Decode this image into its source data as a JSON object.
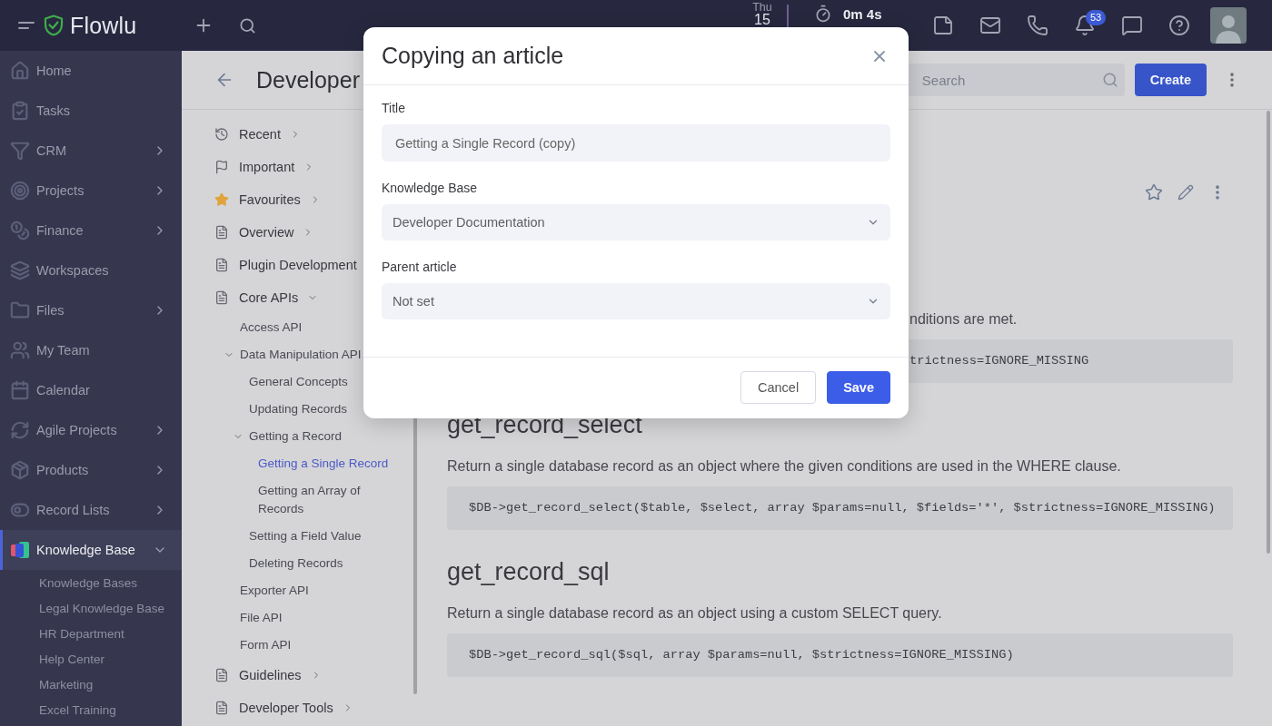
{
  "top_bar": {
    "brand": "Flowlu",
    "date": {
      "weekday": "Thu",
      "day": "15"
    },
    "timer": "0m 4s",
    "notification_count": "53"
  },
  "sidebar": {
    "items": [
      {
        "label": "Home",
        "selected": false
      },
      {
        "label": "Tasks",
        "selected": false
      },
      {
        "label": "CRM",
        "selected": false,
        "expanded": false
      },
      {
        "label": "Projects",
        "selected": false,
        "expanded": false
      },
      {
        "label": "Finance",
        "selected": false,
        "expanded": false
      },
      {
        "label": "Workspaces",
        "selected": false
      },
      {
        "label": "Files",
        "selected": false,
        "expanded": false
      },
      {
        "label": "My Team",
        "selected": false
      },
      {
        "label": "Calendar",
        "selected": false
      },
      {
        "label": "Agile Projects",
        "selected": false,
        "expanded": false
      },
      {
        "label": "Products",
        "selected": false,
        "expanded": false
      },
      {
        "label": "Record Lists",
        "selected": false,
        "expanded": false
      },
      {
        "label": "Knowledge Base",
        "selected": true,
        "expanded": true,
        "children": [
          {
            "label": "Knowledge Bases",
            "selected": false
          },
          {
            "label": "Legal Knowledge Base",
            "selected": false
          },
          {
            "label": "HR Department",
            "selected": false
          },
          {
            "label": "Help Center",
            "selected": false
          },
          {
            "label": "Marketing",
            "selected": false
          },
          {
            "label": "Excel Training",
            "selected": false
          }
        ]
      }
    ]
  },
  "page": {
    "title": "Developer",
    "search": {
      "placeholder": "Search"
    },
    "create_button": "Create"
  },
  "tree": {
    "items": [
      {
        "label": "Recent",
        "selected": false,
        "expanded": false
      },
      {
        "label": "Important",
        "selected": false,
        "expanded": false
      },
      {
        "label": "Favourites",
        "selected": false,
        "expanded": false
      },
      {
        "label": "Overview",
        "selected": false,
        "expanded": false
      },
      {
        "label": "Plugin Development",
        "selected": false
      },
      {
        "label": "Core APIs",
        "selected": false,
        "expanded": true,
        "children": [
          {
            "label": "Access API",
            "selected": false
          },
          {
            "label": "Data Manipulation API",
            "selected": false,
            "expanded": true,
            "children": [
              {
                "label": "General Concepts",
                "selected": false
              },
              {
                "label": "Updating Records",
                "selected": false
              },
              {
                "label": "Getting a Record",
                "selected": false,
                "expanded": true,
                "children": [
                  {
                    "label": "Getting a Single Record",
                    "selected": true
                  },
                  {
                    "label": "Getting an Array of Records",
                    "selected": false
                  }
                ]
              },
              {
                "label": "Setting a Field Value",
                "selected": false
              },
              {
                "label": "Deleting Records",
                "selected": false
              }
            ]
          },
          {
            "label": "Exporter API",
            "selected": false
          },
          {
            "label": "File API",
            "selected": false
          },
          {
            "label": "Form API",
            "selected": false
          }
        ]
      },
      {
        "label": "Guidelines",
        "selected": false,
        "expanded": false
      },
      {
        "label": "Developer Tools",
        "selected": false,
        "expanded": false
      }
    ]
  },
  "article": {
    "behind_dialog": [
      {
        "kind": "text",
        "text": "nditions are met."
      },
      {
        "kind": "code",
        "text": "trictness=IGNORE_MISSING"
      }
    ],
    "sections": [
      {
        "heading": "get_record_select",
        "description": "Return a single database record as an object where the given conditions are used in the WHERE clause.",
        "code": "$DB->get_record_select($table, $select, array $params=null, $fields='*', $strictness=IGNORE_MISSING)"
      },
      {
        "heading": "get_record_sql",
        "description": "Return a single database record as an object using a custom SELECT query.",
        "code": "$DB->get_record_sql($sql, array $params=null, $strictness=IGNORE_MISSING)"
      }
    ]
  },
  "dialog": {
    "title": "Copying an article",
    "fields": [
      {
        "kind": "input",
        "label": "Title",
        "value": "Getting a Single Record (copy)"
      },
      {
        "kind": "select",
        "label": "Knowledge Base",
        "value": "Developer Documentation"
      },
      {
        "kind": "select",
        "label": "Parent article",
        "value": "Not set"
      }
    ],
    "buttons": [
      {
        "kind": "secondary",
        "label": "Cancel"
      },
      {
        "kind": "primary",
        "label": "Save"
      }
    ]
  }
}
